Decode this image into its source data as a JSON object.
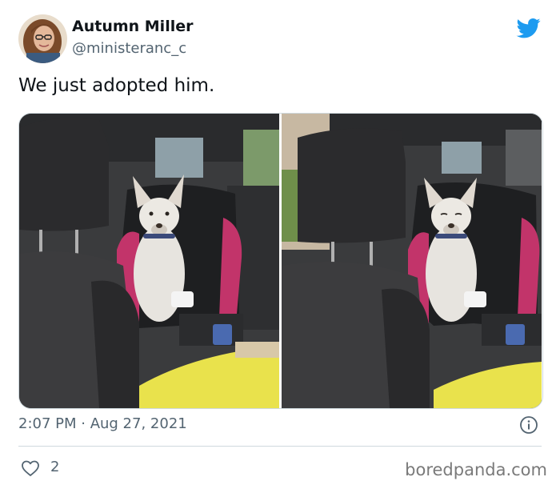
{
  "author": {
    "name": "Autumn Miller",
    "handle": "@ministeranc_c",
    "avatar_icon": "profile-photo-avatar"
  },
  "brand_icon": "twitter-bird-icon",
  "brand_color": "#1d9bf0",
  "tweet": {
    "text": "We just adopted him.",
    "media": [
      {
        "icon": "photo-dog-in-car-seat"
      },
      {
        "icon": "photo-dog-in-car-seat"
      }
    ]
  },
  "meta": {
    "timestamp": "2:07 PM · Aug 27, 2021",
    "info_icon": "info-icon"
  },
  "actions": {
    "like_icon": "heart-icon",
    "like_count": "2"
  },
  "watermark": "boredpanda.com"
}
